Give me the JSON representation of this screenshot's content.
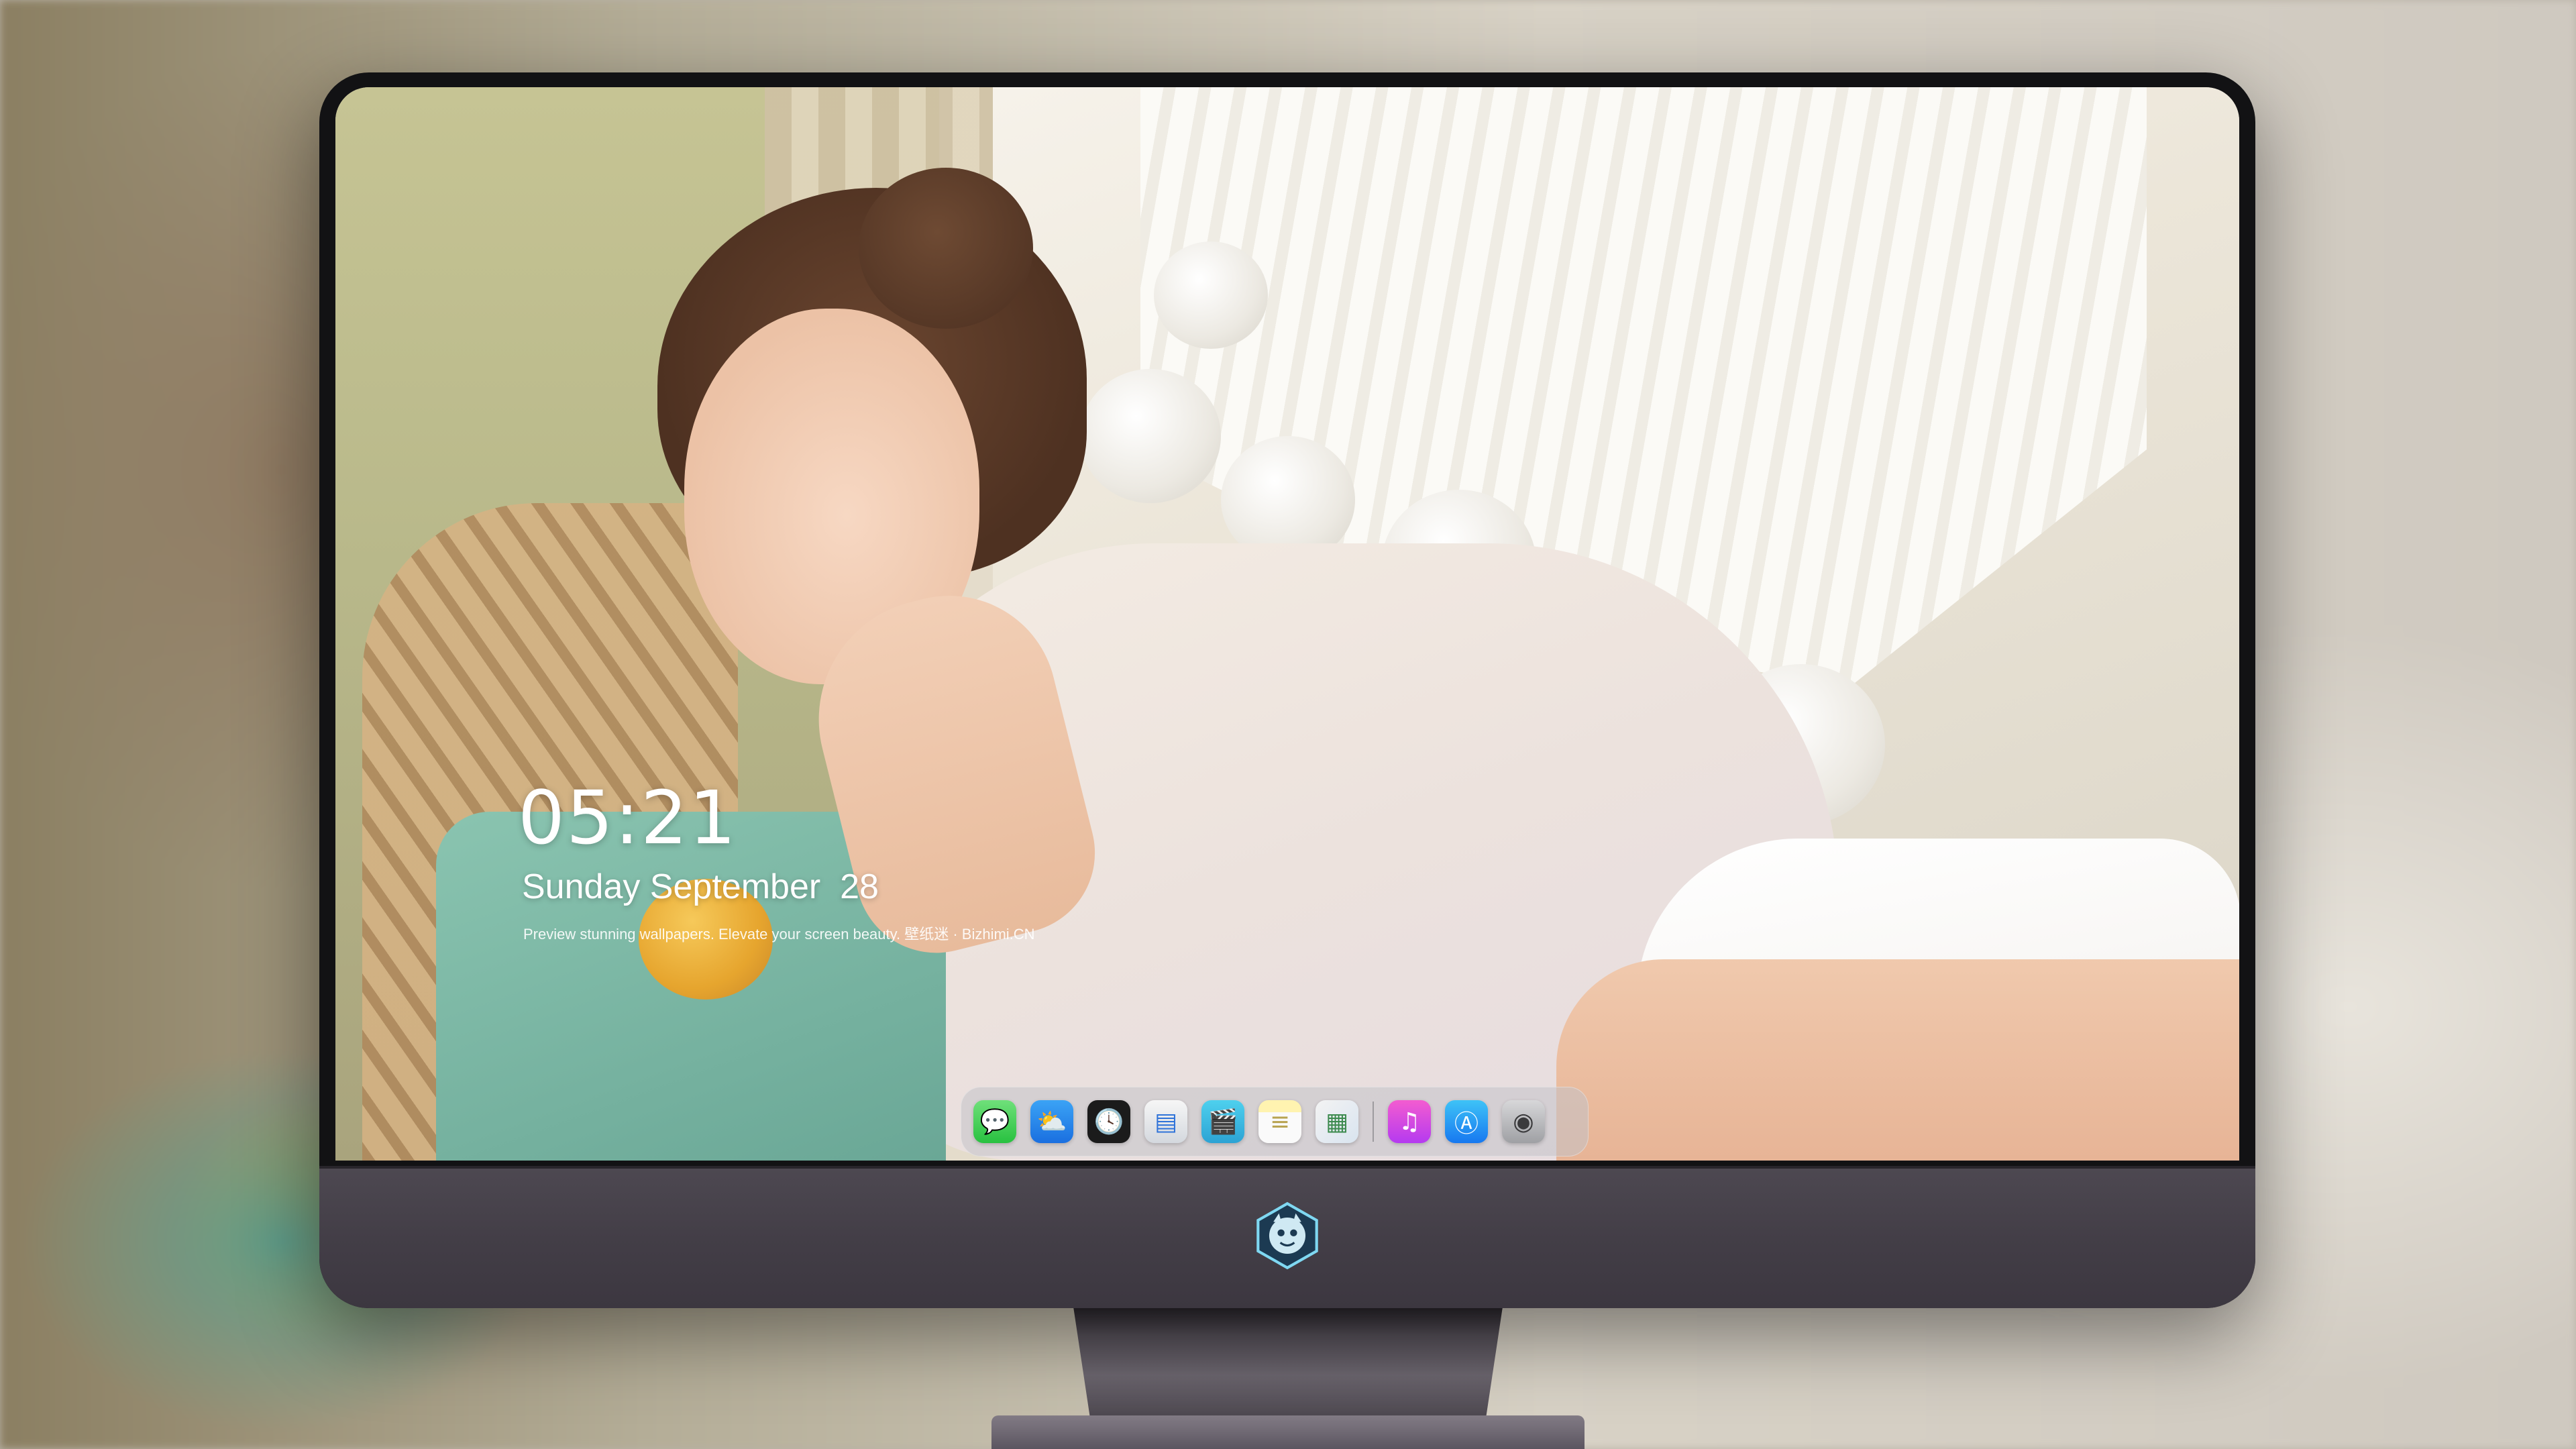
{
  "lock_screen": {
    "time": "05:21",
    "date": "Sunday September  28",
    "tagline": "Preview stunning wallpapers. Elevate your screen beauty. 壁纸迷 · Bizhimi.CN"
  },
  "dock": {
    "apps": [
      {
        "name": "Messages",
        "icon": "messages-icon",
        "glyph": "💬"
      },
      {
        "name": "Weather",
        "icon": "weather-icon",
        "glyph": "⛅"
      },
      {
        "name": "Clock",
        "icon": "clock-icon",
        "glyph": "🕓"
      },
      {
        "name": "Preview",
        "icon": "preview-icon",
        "glyph": "▤"
      },
      {
        "name": "Video",
        "icon": "clapperboard-icon",
        "glyph": "🎬"
      },
      {
        "name": "Notes",
        "icon": "notes-icon",
        "glyph": "≡"
      },
      {
        "name": "Photos",
        "icon": "photo-gallery-icon",
        "glyph": "▦"
      },
      {
        "name": "Music",
        "icon": "music-note-icon",
        "glyph": "♫"
      },
      {
        "name": "App Store",
        "icon": "app-store-icon",
        "glyph": "Ⓐ"
      },
      {
        "name": "Camera",
        "icon": "camera-icon",
        "glyph": "◉"
      }
    ]
  },
  "monitor": {
    "logo": "mascot-logo-icon"
  },
  "colors": {
    "dock_background": "#c3c3c8",
    "bezel": "#121214",
    "chin": "#46414a"
  }
}
